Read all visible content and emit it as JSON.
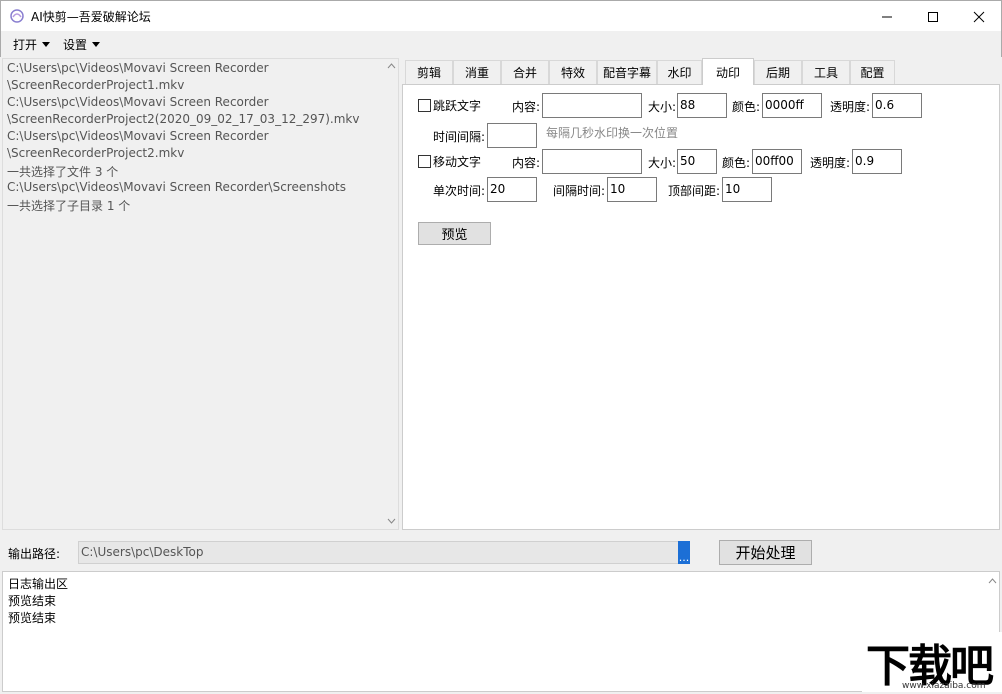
{
  "window": {
    "title": "AI快剪—吾爱破解论坛",
    "minimize": "–",
    "maximize": "☐",
    "close": "✕"
  },
  "menu": {
    "open": "打开",
    "settings": "设置"
  },
  "file_list": {
    "lines": [
      "C:\\Users\\pc\\Videos\\Movavi Screen Recorder",
      "\\ScreenRecorderProject1.mkv",
      "C:\\Users\\pc\\Videos\\Movavi Screen Recorder",
      "\\ScreenRecorderProject2(2020_09_02_17_03_12_297).mkv",
      "C:\\Users\\pc\\Videos\\Movavi Screen Recorder",
      "\\ScreenRecorderProject2.mkv",
      "一共选择了文件 3 个",
      "C:\\Users\\pc\\Videos\\Movavi Screen Recorder\\Screenshots",
      "一共选择了子目录 1 个"
    ]
  },
  "tabs": [
    "剪辑",
    "消重",
    "合并",
    "特效",
    "配音字幕",
    "水印",
    "动印",
    "后期",
    "工具",
    "配置"
  ],
  "active_tab": "动印",
  "jump_text": {
    "checkbox_label": "跳跃文字",
    "content_label": "内容:",
    "content_value": "",
    "size_label": "大小:",
    "size_value": "88",
    "color_label": "颜色:",
    "color_value": "0000ff",
    "opacity_label": "透明度:",
    "opacity_value": "0.6",
    "interval_label": "时间间隔:",
    "interval_value": "",
    "interval_hint": "每隔几秒水印换一次位置"
  },
  "move_text": {
    "checkbox_label": "移动文字",
    "content_label": "内容:",
    "content_value": "",
    "size_label": "大小:",
    "size_value": "50",
    "color_label": "颜色:",
    "color_value": "00ff00",
    "opacity_label": "透明度:",
    "opacity_value": "0.9",
    "single_time_label": "单次时间:",
    "single_time_value": "20",
    "gap_time_label": "间隔时间:",
    "gap_time_value": "10",
    "top_margin_label": "顶部间距:",
    "top_margin_value": "10"
  },
  "preview_button": "预览",
  "output": {
    "label": "输出路径:",
    "path": "C:\\Users\\pc\\DeskTop",
    "browse": "...",
    "start_button": "开始处理"
  },
  "log": {
    "lines": [
      "日志输出区",
      "预览结束",
      "预览结束"
    ]
  },
  "watermark": {
    "text": "下载吧",
    "url": "www.xiazaiba.com"
  }
}
